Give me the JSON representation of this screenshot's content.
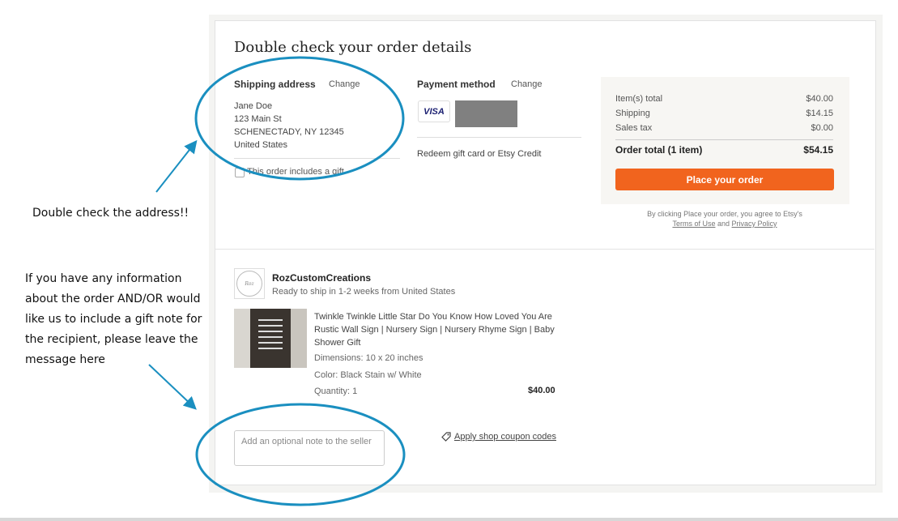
{
  "page": {
    "title": "Double check your order details"
  },
  "shipping": {
    "label": "Shipping address",
    "change": "Change",
    "lines": [
      "Jane Doe",
      "123 Main St",
      "SCHENECTADY, NY 12345",
      "United States"
    ],
    "gift_checkbox_label": "This order includes a gift",
    "gift_checked": false
  },
  "payment": {
    "label": "Payment method",
    "change": "Change",
    "card_brand": "VISA",
    "redeem": "Redeem gift card or Etsy Credit"
  },
  "summary": {
    "rows": [
      {
        "label": "Item(s) total",
        "value": "$40.00"
      },
      {
        "label": "Shipping",
        "value": "$14.15"
      },
      {
        "label": "Sales tax",
        "value": "$0.00"
      }
    ],
    "total_label": "Order total (1 item)",
    "total_value": "$54.15",
    "place_order": "Place your order",
    "legal_prefix": "By clicking Place your order, you agree to Etsy's",
    "terms": "Terms of Use",
    "and": "and",
    "privacy": "Privacy Policy"
  },
  "shop": {
    "name": "RozCustomCreations",
    "ship_note": "Ready to ship in 1-2 weeks from United States"
  },
  "item": {
    "title": "Twinkle Twinkle Little Star Do You Know How Loved You Are Rustic Wall Sign | Nursery Sign | Nursery Rhyme Sign | Baby Shower Gift",
    "dimensions": "Dimensions: 10 x 20 inches",
    "color": "Color: Black Stain w/ White",
    "quantity": "Quantity: 1",
    "price": "$40.00"
  },
  "note": {
    "placeholder": "Add an optional note to the seller"
  },
  "coupon": {
    "label": "Apply shop coupon codes"
  },
  "annotations": {
    "address": "Double check the address!!",
    "note_lines": [
      "If you have any information",
      "about the order AND/OR would",
      "like us to include a gift note for",
      "the recipient, please leave the",
      "message here"
    ],
    "ink_color": "#1a8fc0"
  },
  "colors": {
    "accent": "#f1641e"
  }
}
